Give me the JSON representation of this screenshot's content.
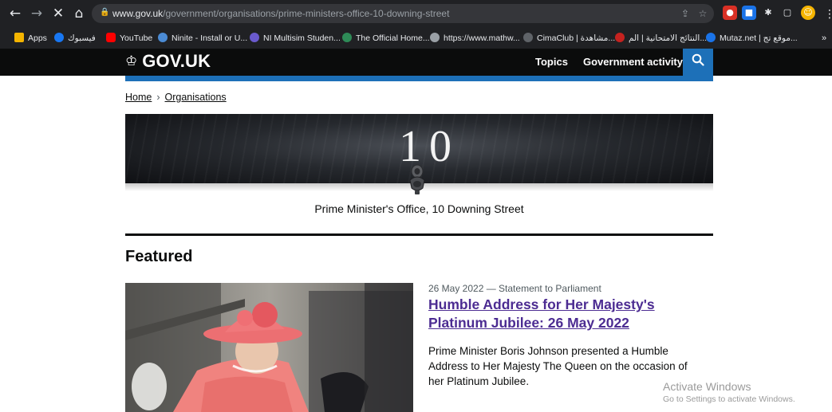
{
  "browser": {
    "url_host": "www.gov.uk",
    "url_path": "/government/organisations/prime-ministers-office-10-downing-street",
    "back_icon": "arrow-left-icon",
    "forward_icon": "arrow-right-icon",
    "stop_icon": "close-icon",
    "home_icon": "home-icon"
  },
  "bookmarks": [
    {
      "label": "Apps",
      "icon": "apps-grid-icon",
      "color": "#f4b400"
    },
    {
      "label": "فيسبوك",
      "icon": "facebook-icon",
      "color": "#1877f2"
    },
    {
      "label": "YouTube",
      "icon": "youtube-icon",
      "color": "#ff0000"
    },
    {
      "label": "Ninite - Install or U...",
      "icon": "ninite-icon",
      "color": "#4b8bd4"
    },
    {
      "label": "NI Multisim Studen...",
      "icon": "multisim-icon",
      "color": "#6a5acd"
    },
    {
      "label": "The Official Home...",
      "icon": "globe-icon",
      "color": "#2e8b57"
    },
    {
      "label": "https://www.mathw...",
      "icon": "globe-icon",
      "color": "#9aa0a6"
    },
    {
      "label": "CimaClub | مشاهدة...",
      "icon": "cimaclub-icon",
      "color": "#5f6368"
    },
    {
      "label": "النتائج الامتحانية | الم...",
      "icon": "results-icon",
      "color": "#c5221f"
    },
    {
      "label": "Mutaz.net | موقع تج...",
      "icon": "mutaz-icon",
      "color": "#1a73e8"
    }
  ],
  "more_bookmarks": "»",
  "gov": {
    "logo_text": "GOV.UK",
    "crown_icon": "crown-icon",
    "nav": [
      {
        "label": "Topics"
      },
      {
        "label": "Government activity"
      }
    ],
    "search_icon": "search-icon",
    "brand_blue": "#1d70b8"
  },
  "breadcrumb": {
    "items": [
      "Home",
      "Organisations"
    ],
    "separator": "›"
  },
  "banner": {
    "number": "10",
    "knocker_icon": "door-knocker-icon"
  },
  "organisation": {
    "name": "Prime Minister's Office, 10 Downing Street"
  },
  "featured": {
    "heading": "Featured",
    "item": {
      "meta": "26 May 2022 — Statement to Parliament",
      "title": "Humble Address for Her Majesty's Platinum Jubilee: 26 May 2022",
      "description": "Prime Minister Boris Johnson presented a Humble Address to Her Majesty The Queen on the occasion of her Platinum Jubilee.",
      "link_color": "#4c2c92"
    }
  },
  "watermark": {
    "title": "Activate Windows",
    "subtitle": "Go to Settings to activate Windows."
  }
}
